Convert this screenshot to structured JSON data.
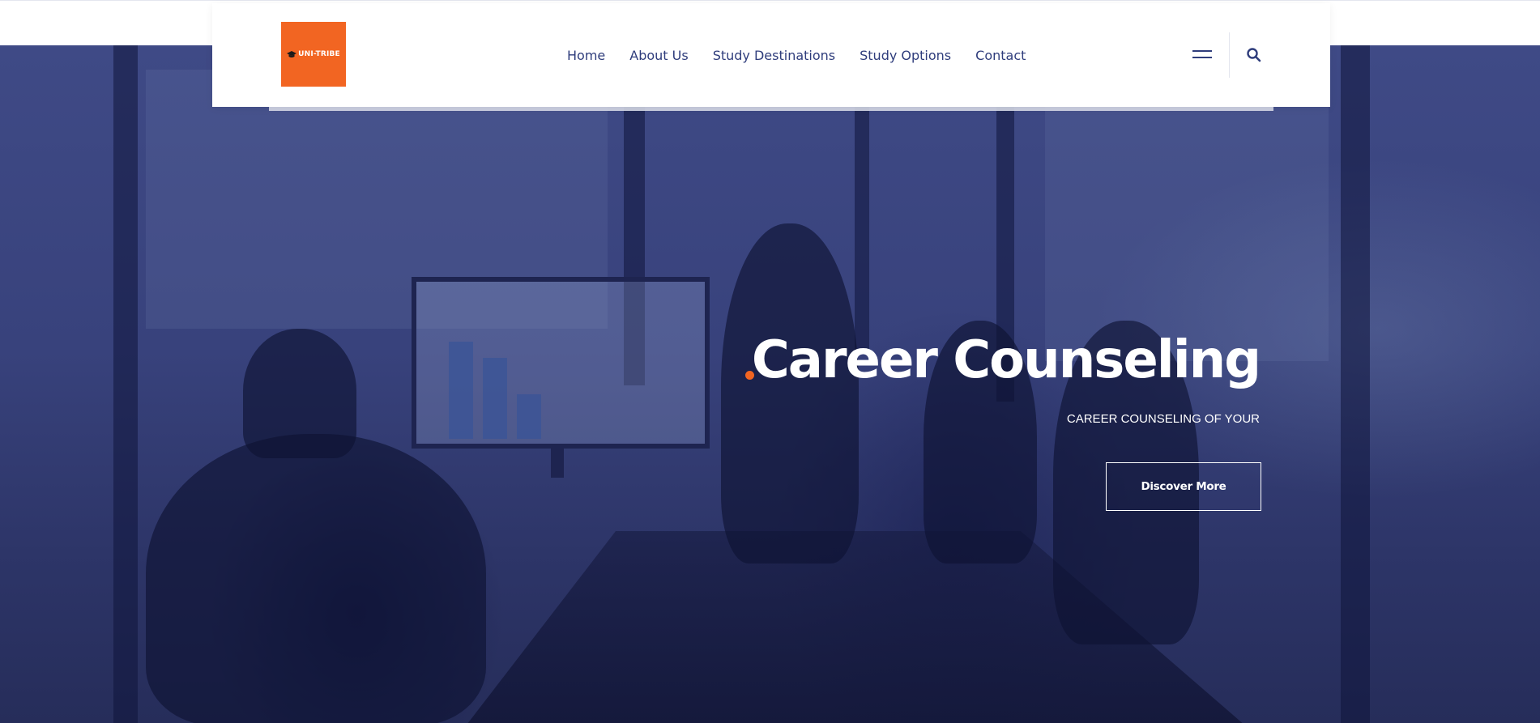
{
  "header": {
    "logo_text": "UNI-TRIBE",
    "nav": [
      {
        "label": "Home"
      },
      {
        "label": "About Us"
      },
      {
        "label": "Study Destinations"
      },
      {
        "label": "Study Options"
      },
      {
        "label": "Contact"
      }
    ],
    "icons": {
      "menu": "hamburger-menu-icon",
      "search": "search-icon",
      "logo": "graduation-cap-icon"
    }
  },
  "hero": {
    "title": "Career Counseling",
    "subtitle": "CAREER COUNSELING OF YOUR",
    "button_label": "Discover More",
    "background": "meeting-room-photo"
  },
  "colors": {
    "brand": "#f26522",
    "nav_text": "#2f3d7c",
    "hero_overlay": "#38427c",
    "white": "#ffffff"
  }
}
